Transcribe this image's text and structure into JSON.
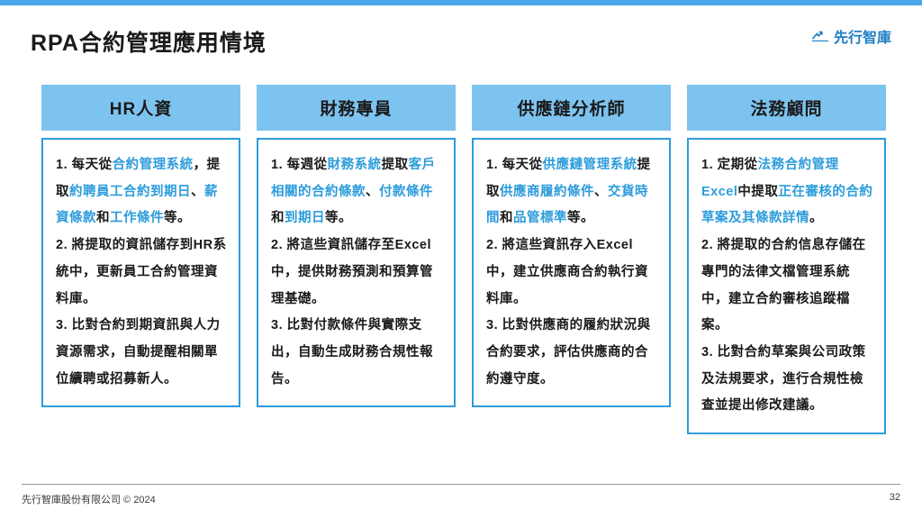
{
  "title": "RPA合約管理應用情境",
  "brand": "先行智庫",
  "columns": [
    {
      "header": "HR人資",
      "body": [
        {
          "t": "1. 每天從",
          "p": true
        },
        {
          "t": "合約管理系統",
          "h": true
        },
        {
          "t": "，提取",
          "p": true
        },
        {
          "t": "約聘員工合約到期日",
          "h": true
        },
        {
          "t": "、",
          "p": true
        },
        {
          "t": "薪資條款",
          "h": true
        },
        {
          "t": "和",
          "p": true
        },
        {
          "t": "工作條件",
          "h": true
        },
        {
          "t": "等。"
        },
        {
          "br": true
        },
        {
          "t": "2. 將提取的資訊儲存到HR系統中，更新員工合約管理資料庫。"
        },
        {
          "br": true
        },
        {
          "t": "3. 比對合約到期資訊與人力資源需求，自動提醒相關單位續聘或招募新人。"
        }
      ]
    },
    {
      "header": "財務專員",
      "body": [
        {
          "t": "1. 每週從"
        },
        {
          "t": "財務系統",
          "h": true
        },
        {
          "t": "提取"
        },
        {
          "t": "客戶相關的合約條款",
          "h": true
        },
        {
          "t": "、"
        },
        {
          "t": "付款條件",
          "h": true
        },
        {
          "t": "和"
        },
        {
          "t": "到期日",
          "h": true
        },
        {
          "t": "等。"
        },
        {
          "br": true
        },
        {
          "t": "2. 將這些資訊儲存至Excel中，提供財務預測和預算管理基礎。"
        },
        {
          "br": true
        },
        {
          "t": "3. 比對付款條件與實際支出，自動生成財務合規性報告。"
        }
      ]
    },
    {
      "header": "供應鏈分析師",
      "body": [
        {
          "t": "1. 每天從"
        },
        {
          "t": "供應鏈管理系統",
          "h": true
        },
        {
          "t": "提取"
        },
        {
          "t": "供應商履約條件",
          "h": true
        },
        {
          "t": "、"
        },
        {
          "t": "交貨時間",
          "h": true
        },
        {
          "t": "和"
        },
        {
          "t": "品管標準",
          "h": true
        },
        {
          "t": "等。"
        },
        {
          "br": true
        },
        {
          "t": "2. 將這些資訊存入Excel中，建立供應商合約執行資料庫。"
        },
        {
          "br": true
        },
        {
          "t": "3. 比對供應商的履約狀況與合約要求，評估供應商的合約遵守度。"
        }
      ]
    },
    {
      "header": "法務顧問",
      "body": [
        {
          "t": "1. 定期從"
        },
        {
          "t": "法務合約管理Excel",
          "h": true
        },
        {
          "t": "中提取"
        },
        {
          "t": "正在審核的合約草案及其條款詳情",
          "h": true
        },
        {
          "t": "。"
        },
        {
          "br": true
        },
        {
          "t": "2. 將提取的合約信息存儲在專門的法律文檔管理系統中，建立合約審核追蹤檔案。"
        },
        {
          "br": true
        },
        {
          "t": "3. 比對合約草案與公司政策及法規要求，進行合規性檢查並提出修改建議。"
        }
      ]
    }
  ],
  "footer": {
    "left": "先行智庫股份有限公司 © 2024",
    "right": "32"
  }
}
